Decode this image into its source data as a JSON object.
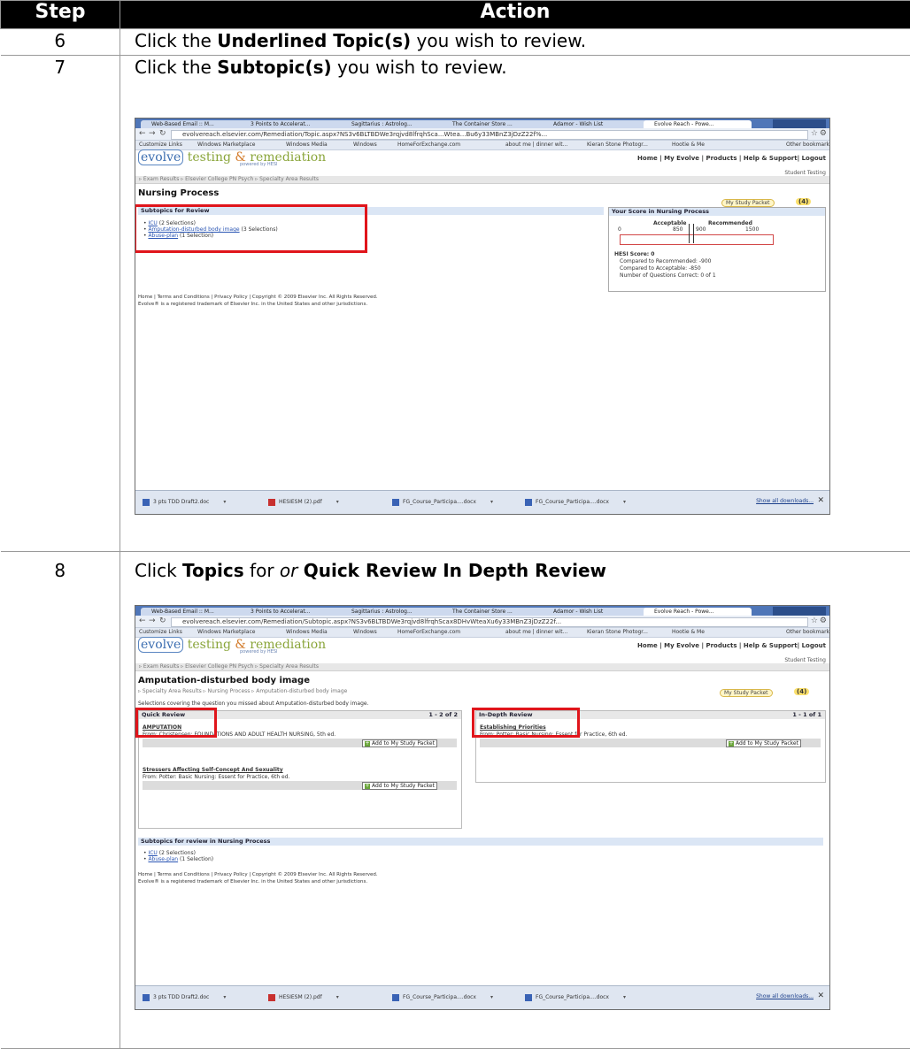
{
  "table": {
    "header_step": "Step",
    "header_action": "Action"
  },
  "steps": [
    {
      "num": "6",
      "pre": "Click the ",
      "bold": "Underlined Topic(s)",
      "post": " you wish to review."
    },
    {
      "num": "7",
      "pre": "Click the ",
      "bold": "Subtopic(s)",
      "post": " you wish to review."
    },
    {
      "num": "8",
      "pre": "Click ",
      "bold": "Topics",
      "mid": " for ",
      "bold2": "Quick Review",
      "italic": " or ",
      "bold3": "In Depth Review"
    }
  ],
  "browser": {
    "tabs": [
      "Web-Based Email :: M...",
      "3 Points to Accelerat...",
      "Sagittarius : Astrolog...",
      "The Container Store ...",
      "Adamor - Wish List",
      "Evolve Reach - Powe..."
    ],
    "url1": "evolvereach.elsevier.com/Remediation/Topic.aspx?NS3v6BLTBDWe3rqjvd8lfrqhSca...Wtea...Bu6y33MBnZ3jDzZ22f%...",
    "url2": "evolvereach.elsevier.com/Remediation/Subtopic.aspx?NS3v6BLTBDWe3rqjvd8lfrqhScax8DHvWteaXu6y33MBnZ3jDzZ22f...",
    "bookmarks": [
      "Customize Links",
      "Windows Marketplace",
      "Windows Media",
      "Windows",
      "HomeForExchange.com",
      "about me | dinner wit...",
      "Kieran Stone Photogr...",
      "Hootie & Me",
      "Other bookmarks"
    ],
    "downloads": [
      "3 pts TDD Draft2.doc",
      "HESIESM (2).pdf",
      "FG_Course_Participa....docx",
      "FG_Course_Participa....docx"
    ],
    "show_all": "Show all downloads...",
    "close": "✕"
  },
  "site": {
    "logo_evolve": "evolve",
    "logo_testing": " testing ",
    "logo_amp": "&",
    "logo_remediation": " remediation",
    "powered": "powered by HESI",
    "nav": "Home | My Evolve | Products | Help & Support| Logout",
    "student": "Student Testing",
    "crumbs": "▹ Exam Results ▹ Elsevier College PN Psych ▹ Specialty Area Results",
    "study_packet": "My Study Packet",
    "study_count": "(4)",
    "footer1": "Home | Terms and Conditions | Privacy Policy | Copyright © 2009 Elsevier Inc. All Rights Reserved.",
    "footer2": "Evolve® is a registered trademark of Elsevier Inc. in the United States and other jurisdictions."
  },
  "shot1": {
    "title": "Nursing Process",
    "subtopics_header": "Subtopics for Review",
    "subtopics": [
      {
        "link": "ICU",
        "note": "(2 Selections)"
      },
      {
        "link": "Amputation-disturbed body image",
        "note": "(3 Selections)"
      },
      {
        "link": "Abuse-plan",
        "note": "(1 Selection)"
      }
    ],
    "score_header": "Your Score in Nursing Process",
    "acceptable": "Acceptable",
    "recommended": "Recommended",
    "tick0": "0",
    "tick850": "850",
    "tick900": "900",
    "tick1500": "1500",
    "hesi": "HESI Score: 0",
    "cmp_rec": "Compared to Recommended: -900",
    "cmp_acc": "Compared to Acceptable: -850",
    "correct": "Number of Questions Correct: 0 of 1"
  },
  "shot2": {
    "title": "Amputation-disturbed body image",
    "crumb2": "▹ Specialty Area Results ▹ Nursing Process ▹ Amputation-disturbed body image",
    "selections": "Selections covering the question you missed about Amputation-disturbed body image.",
    "quick": "Quick Review",
    "quick_count": "1 - 2 of 2",
    "q1_link": "AMPUTATION",
    "q1_from": "From: Christensen: FOUNDATIONS AND ADULT HEALTH NURSING, 5th ed.",
    "q2_link": "Stressers Affecting Self-Concept And Sexuality",
    "q2_from": "From: Potter: Basic Nursing: Essent for Practice, 6th ed.",
    "indepth": "In-Depth Review",
    "indepth_count": "1 - 1 of 1",
    "d1_link": "Establishing Priorities",
    "d1_from": "From: Potter: Basic Nursing: Essent for Practice, 6th ed.",
    "add": "Add to My Study Packet",
    "sub_header": "Subtopics for review in Nursing Process",
    "subs": [
      {
        "link": "ICU",
        "note": "(2 Selections)"
      },
      {
        "link": "Abuse-plan",
        "note": "(1 Selection)"
      }
    ]
  },
  "colors": {
    "red_box": "#e0151b",
    "header_bg": "#000000",
    "link": "#2b56b4"
  }
}
